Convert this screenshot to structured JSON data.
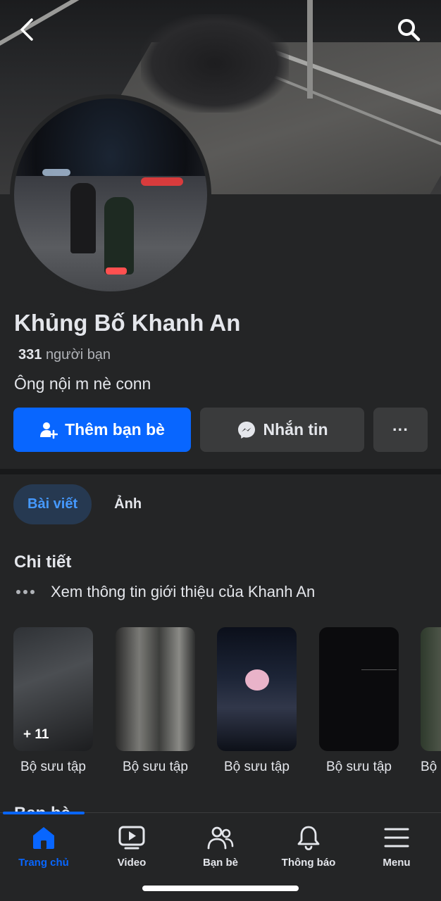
{
  "profile": {
    "name": "Khủng Bố Khanh An",
    "friend_count": "331",
    "friend_label": "người bạn",
    "bio": "Ông nội m nè conn"
  },
  "actions": {
    "add_friend": "Thêm bạn bè",
    "message": "Nhắn tin",
    "more": "···"
  },
  "tabs": [
    {
      "label": "Bài viết",
      "active": true
    },
    {
      "label": "Ảnh",
      "active": false
    }
  ],
  "details": {
    "title": "Chi tiết",
    "intro_link": "Xem thông tin giới thiệu của Khanh An"
  },
  "collections": [
    {
      "label": "Bộ sưu tập",
      "count": "+ 11"
    },
    {
      "label": "Bộ sưu tập"
    },
    {
      "label": "Bộ sưu tập"
    },
    {
      "label": "Bộ sưu tập"
    },
    {
      "label": "Bộ"
    }
  ],
  "friends_section": {
    "title": "Bạn bè"
  },
  "bottom_nav": [
    {
      "label": "Trang chủ",
      "icon": "home-icon",
      "active": true
    },
    {
      "label": "Video",
      "icon": "video-icon",
      "active": false
    },
    {
      "label": "Bạn bè",
      "icon": "friends-icon",
      "active": false
    },
    {
      "label": "Thông báo",
      "icon": "bell-icon",
      "active": false
    },
    {
      "label": "Menu",
      "icon": "menu-icon",
      "active": false
    }
  ],
  "colors": {
    "accent": "#0866ff",
    "background": "#242526",
    "button_secondary": "#3a3b3c"
  }
}
